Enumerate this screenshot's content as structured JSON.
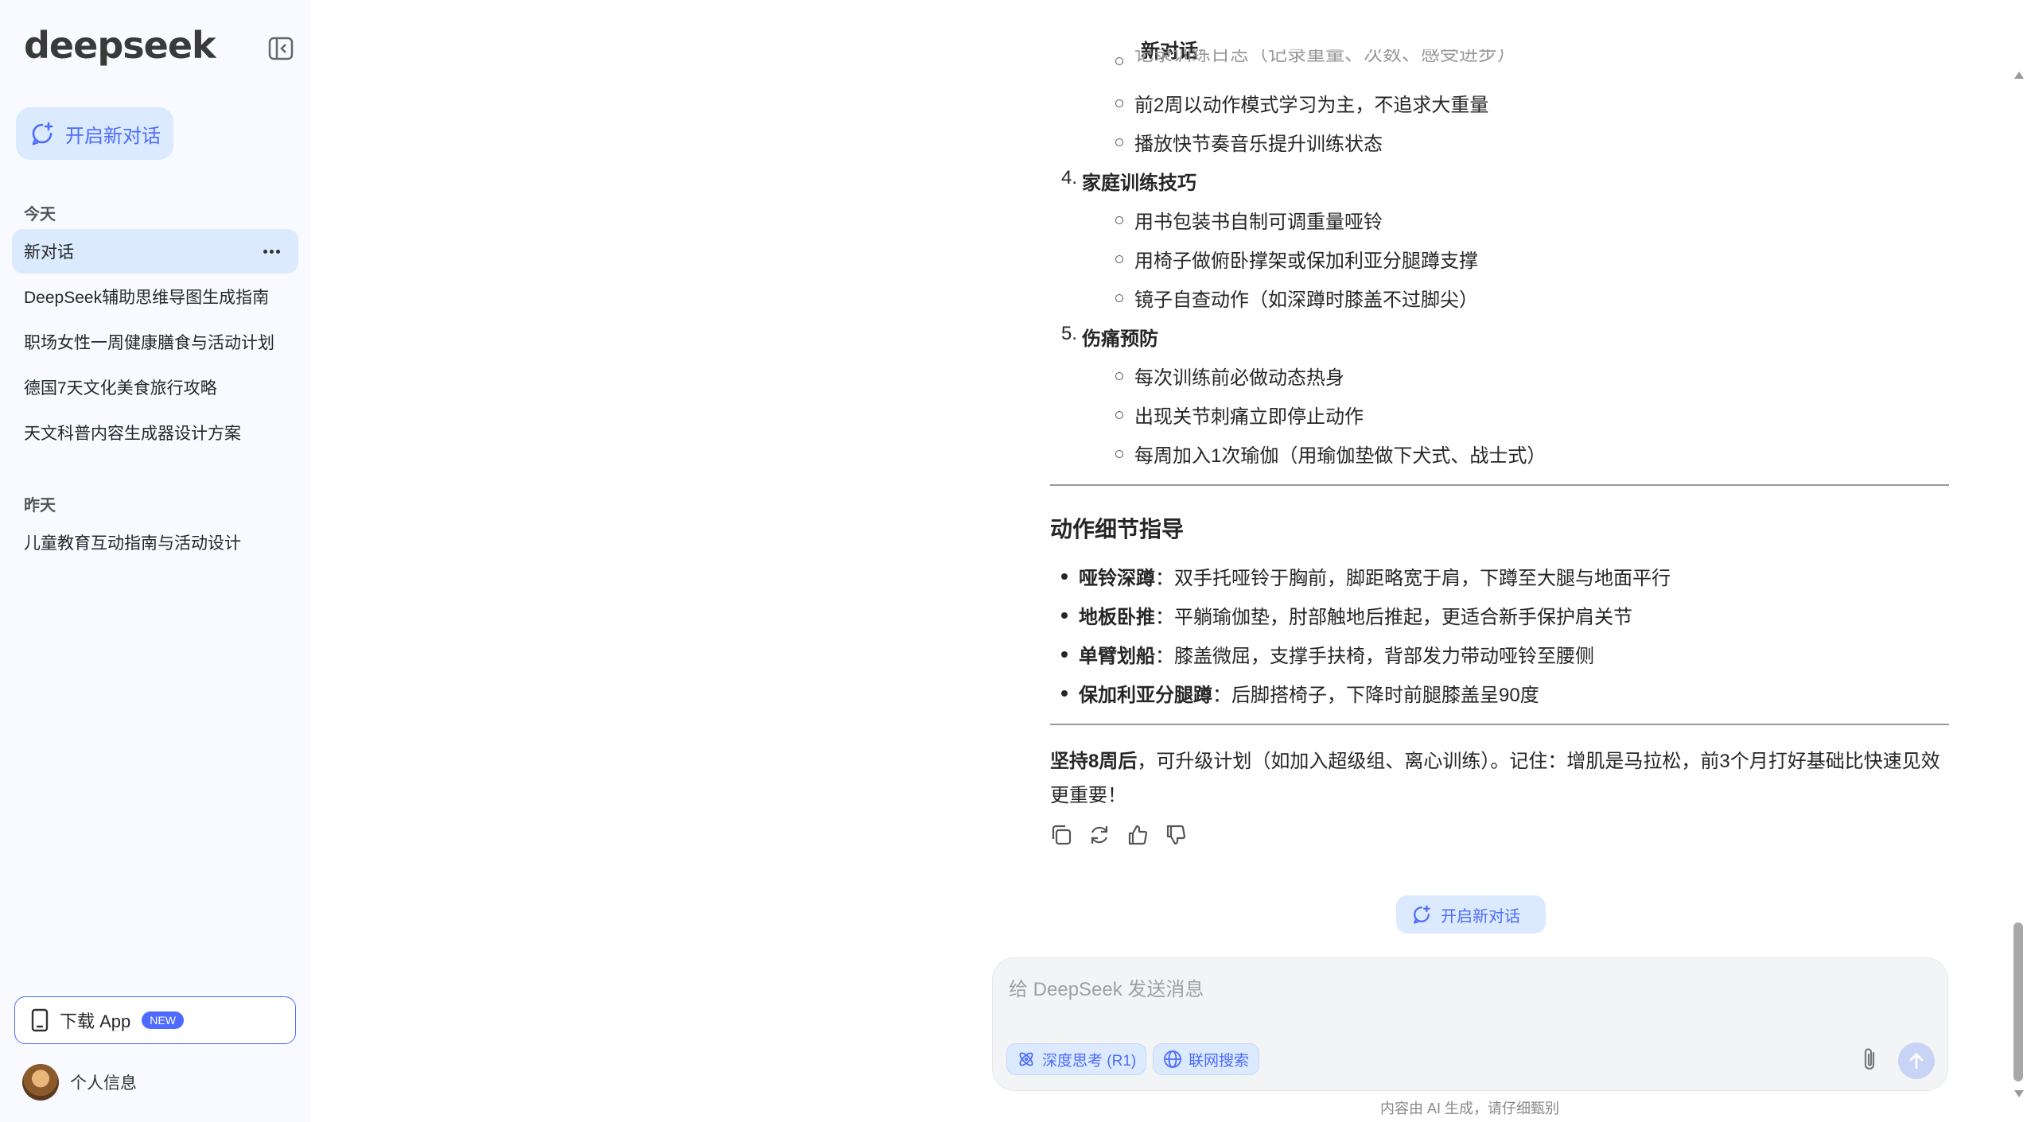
{
  "sidebar": {
    "logo": "deepseek",
    "new_chat_label": "开启新对话",
    "today_label": "今天",
    "yesterday_label": "昨天",
    "today_items": [
      {
        "label": "新对话"
      },
      {
        "label": "DeepSeek辅助思维导图生成指南"
      },
      {
        "label": "职场女性一周健康膳食与活动计划"
      },
      {
        "label": "德国7天文化美食旅行攻略"
      },
      {
        "label": "天文科普内容生成器设计方案"
      }
    ],
    "yesterday_items": [
      {
        "label": "儿童教育互动指南与活动设计"
      }
    ],
    "download_label": "下载 App",
    "new_badge": "NEW",
    "profile_label": "个人信息"
  },
  "header": {
    "title": "新对话"
  },
  "message": {
    "top_items": [
      "前2周以动作模式学习为主，不追求大重量",
      "播放快节奏音乐提升训练状态"
    ],
    "sections": [
      {
        "num": "4.",
        "title": "家庭训练技巧",
        "items": [
          "用书包装书自制可调重量哑铃",
          "用椅子做俯卧撑架或保加利亚分腿蹲支撑",
          "镜子自查动作（如深蹲时膝盖不过脚尖）"
        ]
      },
      {
        "num": "5.",
        "title": "伤痛预防",
        "items": [
          "每次训练前必做动态热身",
          "出现关节刺痛立即停止动作",
          "每周加入1次瑜伽（用瑜伽垫做下犬式、战士式）"
        ]
      }
    ],
    "heading": "动作细节指导",
    "bullets": [
      {
        "term": "哑铃深蹲",
        "text": "：双手托哑铃于胸前，脚距略宽于肩，下蹲至大腿与地面平行"
      },
      {
        "term": "地板卧推",
        "text": "：平躺瑜伽垫，肘部触地后推起，更适合新手保护肩关节"
      },
      {
        "term": "单臂划船",
        "text": "：膝盖微屈，支撑手扶椅，背部发力带动哑铃至腰侧"
      },
      {
        "term": "保加利亚分腿蹲",
        "text": "：后脚搭椅子，下降时前腿膝盖呈90度"
      }
    ],
    "conclusion_bold": "坚持8周后",
    "conclusion_text": "，可升级计划（如加入超级组、离心训练）。记住：增肌是马拉松，前3个月打好基础比快速见效更重要！"
  },
  "new_chat_pill": "开启新对话",
  "input": {
    "placeholder": "给 DeepSeek 发送消息",
    "deep_think_label": "深度思考 (R1)",
    "web_search_label": "联网搜索"
  },
  "disclaimer": "内容由 AI 生成，请仔细甄别",
  "colors": {
    "accent": "#4d6bfe",
    "accent_light": "#dbeafe",
    "sidebar_bg": "#f8faff"
  }
}
